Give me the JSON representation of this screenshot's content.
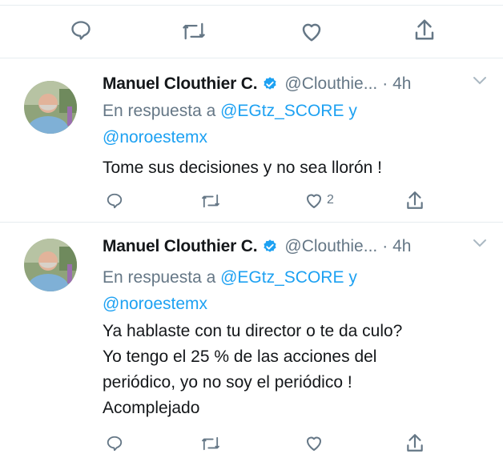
{
  "tweets": [
    {
      "name": "Manuel Clouthier C.",
      "handle": "@Clouthie...",
      "time": "· 4h",
      "reply_prefix": "En respuesta a",
      "mention1": "@EGtz_SCORE",
      "joiner": "y",
      "mention2": "@noroestemx",
      "lines": [
        "Tome sus decisiones y no sea llorón !"
      ],
      "likes": "2"
    },
    {
      "name": "Manuel Clouthier C.",
      "handle": "@Clouthie...",
      "time": "· 4h",
      "reply_prefix": "En respuesta a",
      "mention1": "@EGtz_SCORE",
      "joiner": "y",
      "mention2": "@noroestemx",
      "lines": [
        "Ya hablaste con tu director o te da culo?",
        "Yo tengo el 25 % de las acciones del",
        "periódico, yo no soy el periódico !",
        "Acomplejado"
      ],
      "likes": ""
    }
  ],
  "icons": {
    "reply": "reply-icon",
    "retweet": "retweet-icon",
    "like": "heart-icon",
    "share": "share-icon",
    "verified": "verified-badge-icon",
    "caret": "chevron-down-icon"
  },
  "colors": {
    "accent": "#1da1f2",
    "muted": "#657786",
    "text": "#14171a",
    "divider": "#e6ecf0"
  }
}
